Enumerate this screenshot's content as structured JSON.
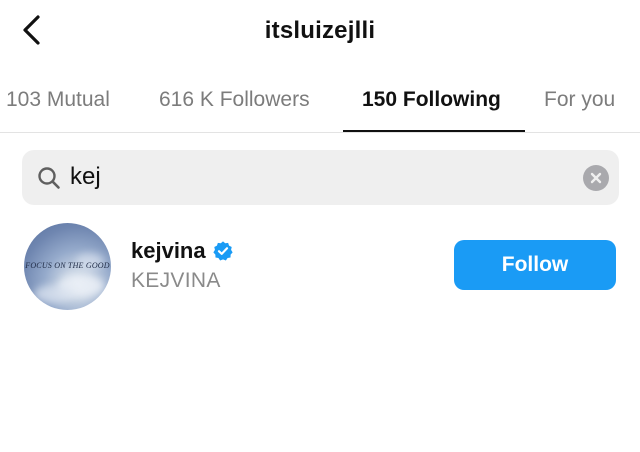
{
  "header": {
    "title": "itsluizejlli",
    "back_icon": "chevron-left-icon"
  },
  "tabs": [
    {
      "label": "103 Mutual",
      "active": false
    },
    {
      "label": "616 K Followers",
      "active": false
    },
    {
      "label": "150 Following",
      "active": true
    },
    {
      "label": "For you",
      "active": false
    }
  ],
  "search": {
    "value": "kej",
    "icon": "search-icon",
    "clear_icon": "clear-icon"
  },
  "results": [
    {
      "username": "kejvina",
      "verified": true,
      "full_name": "KEJVINA",
      "avatar_text": "FOCUS ON THE GOOD",
      "button_label": "Follow"
    }
  ],
  "colors": {
    "accent": "#1a9bf5",
    "verified": "#1a9bf5",
    "muted_text": "#7c7c7c",
    "search_bg": "#efefef"
  }
}
